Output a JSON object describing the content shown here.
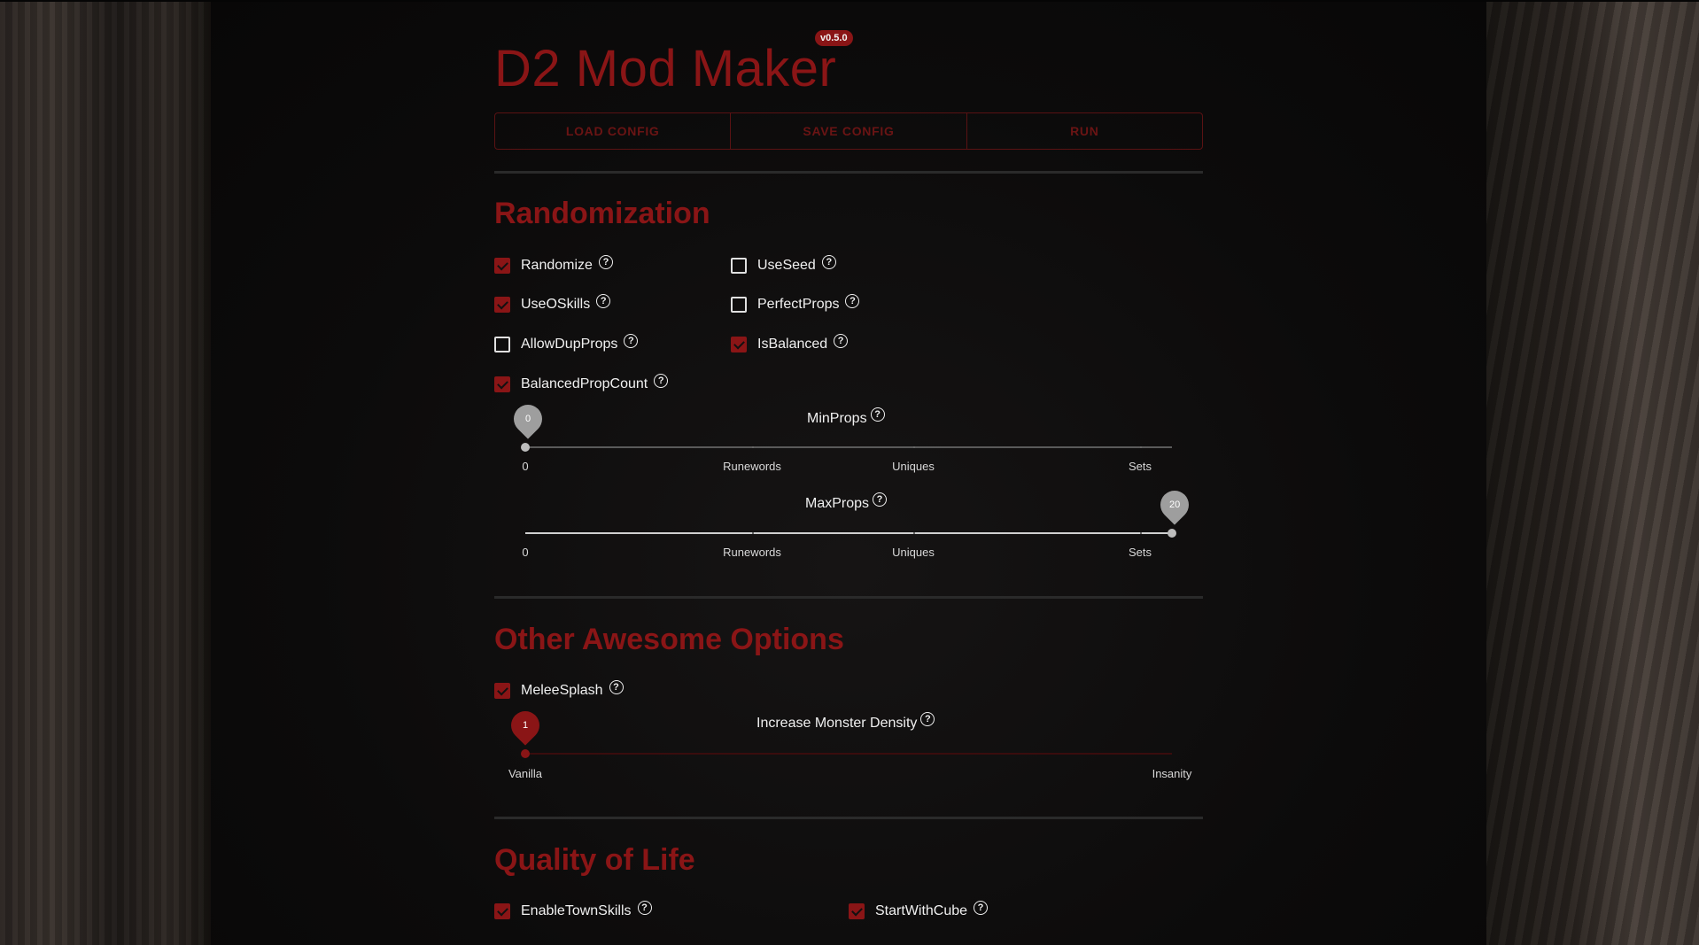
{
  "app": {
    "title": "D2 Mod Maker",
    "version": "v0.5.0"
  },
  "toolbar": {
    "load": "LOAD CONFIG",
    "save": "SAVE CONFIG",
    "run": "RUN"
  },
  "randomization": {
    "title": "Randomization",
    "options": [
      {
        "label": "Randomize",
        "checked": true
      },
      {
        "label": "UseSeed",
        "checked": false
      },
      {
        "label": "UseOSkills",
        "checked": true
      },
      {
        "label": "PerfectProps",
        "checked": false
      },
      {
        "label": "AllowDupProps",
        "checked": false
      },
      {
        "label": "IsBalanced",
        "checked": true
      },
      {
        "label": "BalancedPropCount",
        "checked": true
      }
    ],
    "min_props": {
      "label": "MinProps",
      "value": 0,
      "value_text": "0",
      "marks": [
        "0",
        "Runewords",
        "Uniques",
        "Sets"
      ]
    },
    "max_props": {
      "label": "MaxProps",
      "value": 20,
      "value_text": "20",
      "marks": [
        "0",
        "Runewords",
        "Uniques",
        "Sets"
      ]
    }
  },
  "other": {
    "title": "Other Awesome Options",
    "melee_splash": {
      "label": "MeleeSplash",
      "checked": true
    },
    "monster_density": {
      "label": "Increase Monster Density",
      "value": 1,
      "value_text": "1",
      "min_label": "Vanilla",
      "max_label": "Insanity"
    }
  },
  "qol": {
    "title": "Quality of Life",
    "options": [
      {
        "label": "EnableTownSkills",
        "checked": true
      },
      {
        "label": "StartWithCube",
        "checked": true
      }
    ]
  },
  "colors": {
    "accent": "#8a1516",
    "background": "#0b0b0b"
  }
}
